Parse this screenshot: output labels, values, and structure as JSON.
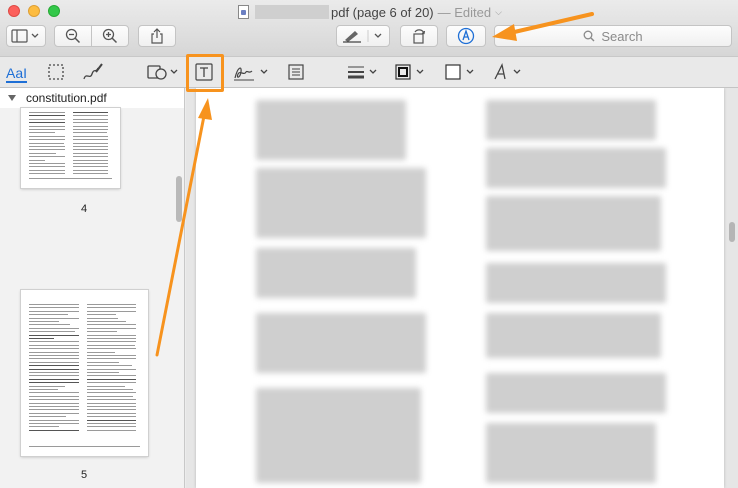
{
  "window": {
    "title_suffix": "pdf (page 6 of 20)",
    "edited_label": "— Edited",
    "title_chevron": "⌵"
  },
  "toolbar": {
    "search_placeholder": "Search"
  },
  "markup": {
    "text_selection_label": "AaI"
  },
  "sidebar": {
    "file_name": "constitution.pdf",
    "pages": [
      {
        "label": "4"
      },
      {
        "label": "5"
      }
    ]
  },
  "colors": {
    "annotation_orange": "#f7931e",
    "accent_blue": "#1e6fd6"
  }
}
